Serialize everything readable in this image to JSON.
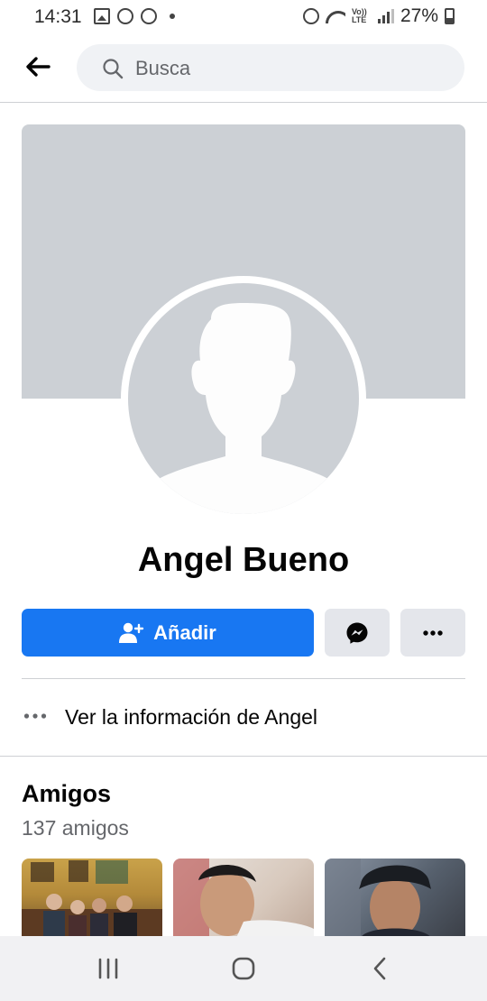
{
  "status_bar": {
    "time": "14:31",
    "battery": "27%",
    "network_badge": "Vo)) LTE"
  },
  "header": {
    "back_icon": "arrow-left-icon",
    "search_placeholder": "Busca"
  },
  "profile": {
    "name": "Angel Bueno",
    "add_button_label": "Añadir",
    "add_icon": "person-plus-icon",
    "messenger_icon": "messenger-icon",
    "more_icon": "more-dots-icon",
    "info_label": "Ver la información de Angel"
  },
  "friends": {
    "title": "Amigos",
    "count_text": "137 amigos"
  },
  "colors": {
    "primary": "#1877f2",
    "secondary_button": "#e4e6eb",
    "placeholder_gray": "#ccd0d5",
    "muted_text": "#65676b"
  }
}
